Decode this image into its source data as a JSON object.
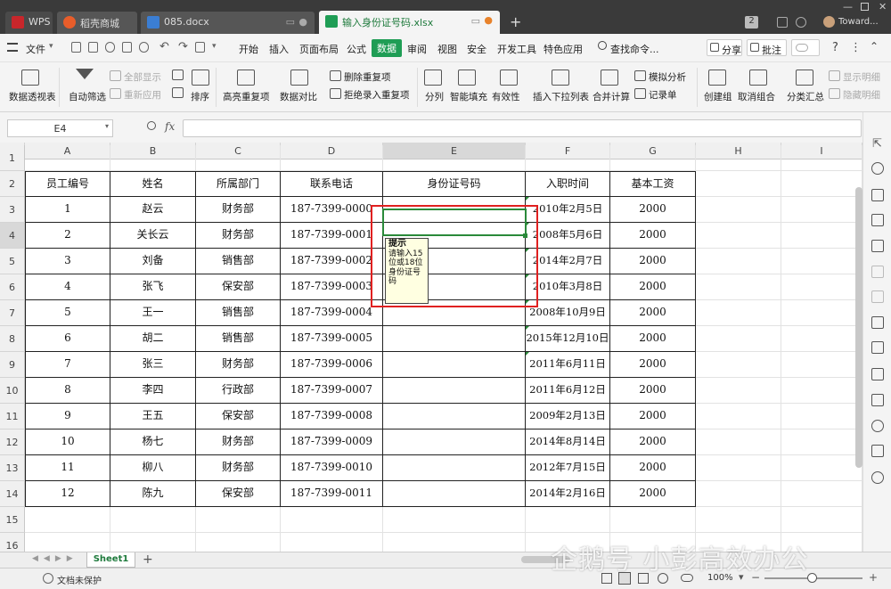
{
  "titlebar": {
    "tabs": [
      {
        "label": "WPS"
      },
      {
        "label": "稻壳商城"
      },
      {
        "label": "085.docx"
      },
      {
        "label": "输入身份证号码.xlsx"
      }
    ],
    "new_tab": "+",
    "page_count": "2",
    "user": "Toward..."
  },
  "menu": {
    "file": "文件",
    "items": [
      "开始",
      "插入",
      "页面布局",
      "公式",
      "数据",
      "审阅",
      "视图",
      "安全",
      "开发工具",
      "特色应用"
    ],
    "active": "数据",
    "search": "查找命令...",
    "share": "分享",
    "annotate": "批注",
    "help": "?"
  },
  "ribbon": {
    "pivot": "数据透视表",
    "autofilter": "自动筛选",
    "show_all": "全部显示",
    "reapply": "重新应用",
    "sort": "排序",
    "highlight_dup": "高亮重复项",
    "compare": "数据对比",
    "delete_dup": "删除重复项",
    "reject_dup": "拒绝录入重复项",
    "split": "分列",
    "smart_fill": "智能填充",
    "validity": "有效性",
    "dropdown": "插入下拉列表",
    "consolidate": "合并计算",
    "whatif": "模拟分析",
    "record": "记录单",
    "group": "创建组",
    "ungroup": "取消组合",
    "subtotal": "分类汇总",
    "show_detail": "显示明细",
    "hide_detail": "隐藏明细"
  },
  "formula_bar": {
    "cell_ref": "E4",
    "fx": "fx",
    "value": ""
  },
  "columns": [
    "A",
    "B",
    "C",
    "D",
    "E",
    "F",
    "G",
    "H",
    "I"
  ],
  "selected_column": "E",
  "selected_row": "4",
  "row_numbers": [
    "1",
    "2",
    "3",
    "4",
    "5",
    "6",
    "7",
    "8",
    "9",
    "10",
    "11",
    "12",
    "13",
    "14",
    "15",
    "16"
  ],
  "table": {
    "headers": [
      "员工编号",
      "姓名",
      "所属部门",
      "联系电话",
      "身份证号码",
      "入职时间",
      "基本工资"
    ],
    "rows": [
      [
        "1",
        "赵云",
        "财务部",
        "187-7399-0000",
        "",
        "2010年2月5日",
        "2000"
      ],
      [
        "2",
        "关长云",
        "财务部",
        "187-7399-0001",
        "",
        "2008年5月6日",
        "2000"
      ],
      [
        "3",
        "刘备",
        "销售部",
        "187-7399-0002",
        "",
        "2014年2月7日",
        "2000"
      ],
      [
        "4",
        "张飞",
        "保安部",
        "187-7399-0003",
        "",
        "2010年3月8日",
        "2000"
      ],
      [
        "5",
        "王一",
        "销售部",
        "187-7399-0004",
        "",
        "2008年10月9日",
        "2000"
      ],
      [
        "6",
        "胡二",
        "销售部",
        "187-7399-0005",
        "",
        "2015年12月10日",
        "2000"
      ],
      [
        "7",
        "张三",
        "财务部",
        "187-7399-0006",
        "",
        "2011年6月11日",
        "2000"
      ],
      [
        "8",
        "李四",
        "行政部",
        "187-7399-0007",
        "",
        "2011年6月12日",
        "2000"
      ],
      [
        "9",
        "王五",
        "保安部",
        "187-7399-0008",
        "",
        "2009年2月13日",
        "2000"
      ],
      [
        "10",
        "杨七",
        "财务部",
        "187-7399-0009",
        "",
        "2014年8月14日",
        "2000"
      ],
      [
        "11",
        "柳八",
        "财务部",
        "187-7399-0010",
        "",
        "2012年7月15日",
        "2000"
      ],
      [
        "12",
        "陈九",
        "保安部",
        "187-7399-0011",
        "",
        "2014年2月16日",
        "2000"
      ]
    ]
  },
  "tooltip": {
    "title": "提示",
    "text": "请输入15位或18位身份证号码"
  },
  "sheets": {
    "active": "Sheet1",
    "add": "+"
  },
  "status": {
    "protection": "文档未保护",
    "zoom": "100%"
  },
  "watermark": "企鹅号 小彭高效办公",
  "colors": {
    "accent_green": "#1f9d55",
    "annotation_red": "#e02020",
    "tooltip_bg": "#ffffe1"
  }
}
